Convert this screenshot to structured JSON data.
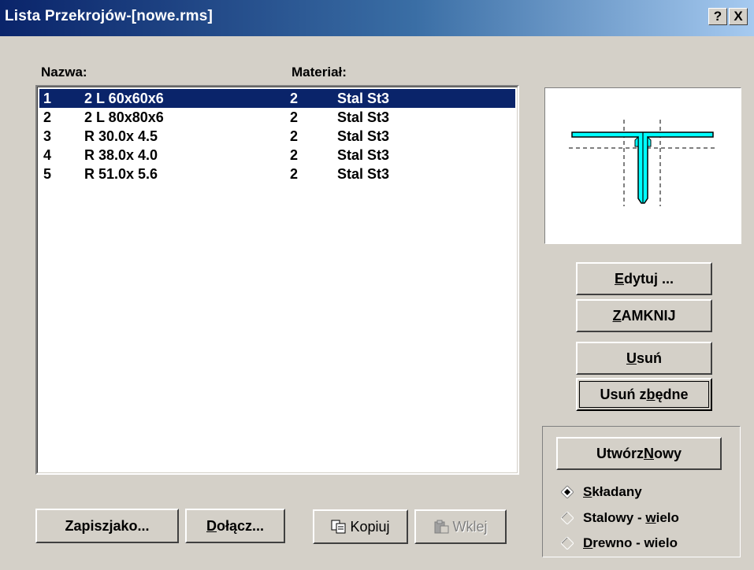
{
  "window": {
    "title": "Lista Przekrojów-[nowe.rms]",
    "help_label": "?",
    "close_label": "X"
  },
  "list": {
    "headers": {
      "name": "Nazwa:",
      "material": "Materiał:"
    },
    "rows": [
      {
        "num": "1",
        "name": "2 L 60x60x6",
        "mat_num": "2",
        "mat_name": "Stal St3",
        "selected": true
      },
      {
        "num": "2",
        "name": "2 L 80x80x6",
        "mat_num": "2",
        "mat_name": "Stal St3"
      },
      {
        "num": "3",
        "name": "R 30.0x 4.5",
        "mat_num": "2",
        "mat_name": "Stal St3"
      },
      {
        "num": "4",
        "name": "R 38.0x 4.0",
        "mat_num": "2",
        "mat_name": "Stal St3"
      },
      {
        "num": "5",
        "name": "R 51.0x 5.6",
        "mat_num": "2",
        "mat_name": "Stal St3"
      }
    ]
  },
  "buttons": {
    "edytuj": {
      "pre": "",
      "key": "E",
      "post": "dytuj ..."
    },
    "zamknij": {
      "pre": "",
      "key": "Z",
      "post": "AMKNIJ"
    },
    "usun": {
      "pre": "",
      "key": "U",
      "post": "suń"
    },
    "usun_zbedne": {
      "pre": "Usuń z",
      "key": "b",
      "post": "ędne"
    },
    "utworz": {
      "pre": "Utwórz ",
      "key": "N",
      "post": "owy"
    },
    "zapisz": {
      "pre": "Zapisz ",
      "key": "j",
      "post": "ako..."
    },
    "dolacz": {
      "pre": "",
      "key": "D",
      "post": "ołącz..."
    },
    "kopiuj": {
      "label": "Kopiuj",
      "icon": "copy-icon"
    },
    "wklej": {
      "label": "Wklej",
      "icon": "paste-icon"
    }
  },
  "radios": [
    {
      "pre": "",
      "key": "S",
      "post": "kładany",
      "checked": true
    },
    {
      "pre": "Stalowy - ",
      "key": "w",
      "post": "ielo",
      "checked": false
    },
    {
      "pre": "",
      "key": "D",
      "post": "rewno - wielo",
      "checked": false
    }
  ],
  "colors": {
    "selection": "#0a246a",
    "section_fill": "#00ffff",
    "face": "#d4d0c8"
  }
}
